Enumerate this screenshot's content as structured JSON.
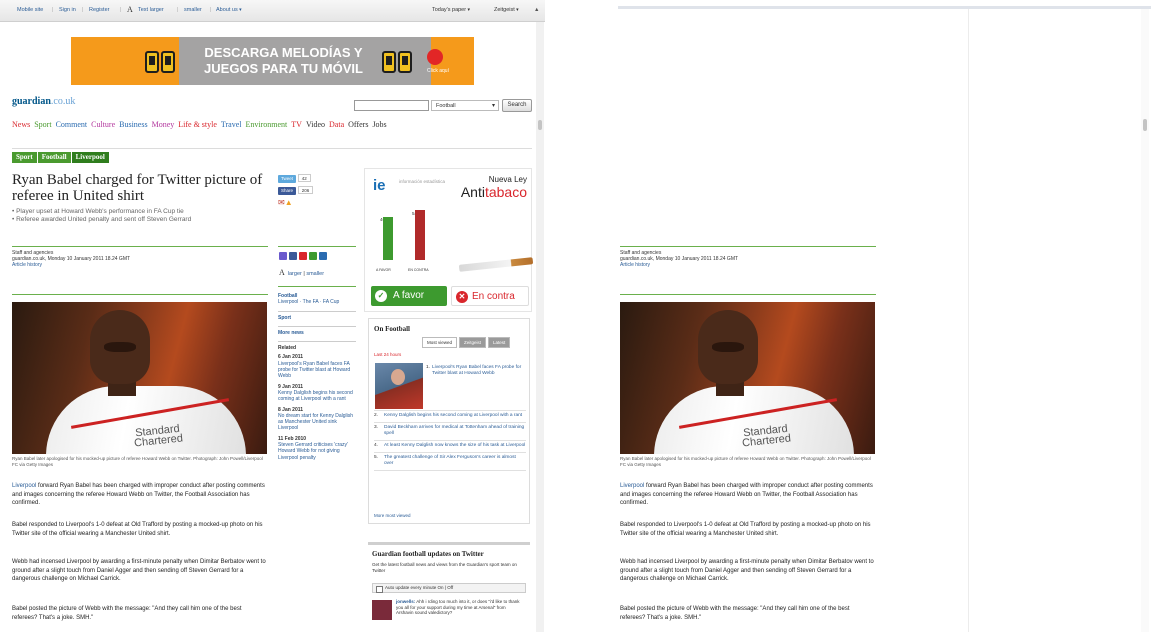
{
  "topbar": {
    "links": [
      "Mobile site",
      "Sign in",
      "Register",
      "Text larger",
      "smaller",
      "About us"
    ],
    "text_glyph": "A",
    "todays_paper": "Today's paper",
    "zeitgeist": "Zeitgeist"
  },
  "ad": {
    "text": "DESCARGA MELODÍAS Y JUEGOS PARA TU MÓVIL",
    "click": "Click aquí"
  },
  "logo": {
    "main": "guardian",
    "suffix": ".co.uk"
  },
  "search": {
    "select_value": "Football",
    "button": "Search"
  },
  "nav": {
    "items": [
      {
        "label": "News",
        "color": "#d9262c"
      },
      {
        "label": "Sport",
        "color": "#4a9a2f"
      },
      {
        "label": "Comment",
        "color": "#2a6bb0"
      },
      {
        "label": "Culture",
        "color": "#b3379e"
      },
      {
        "label": "Business",
        "color": "#2a6bb0"
      },
      {
        "label": "Money",
        "color": "#b3379e"
      },
      {
        "label": "Life & style",
        "color": "#d9262c"
      },
      {
        "label": "Travel",
        "color": "#2a6bb0"
      },
      {
        "label": "Environment",
        "color": "#4a9a2f"
      },
      {
        "label": "TV",
        "color": "#d9262c"
      },
      {
        "label": "Video",
        "color": "#333333"
      },
      {
        "label": "Data",
        "color": "#d9262c"
      },
      {
        "label": "Offers",
        "color": "#333333"
      },
      {
        "label": "Jobs",
        "color": "#333333"
      }
    ]
  },
  "breadcrumbs": [
    "Sport",
    "Football",
    "Liverpool"
  ],
  "article": {
    "headline": "Ryan Babel charged for Twitter picture of referee in United shirt",
    "standfirst": [
      "• Player upset at Howard Webb's performance in FA Cup tie",
      "• Referee awarded United penalty and sent off Steven Gerrard"
    ],
    "byline": {
      "author": "Staff and agencies",
      "date": "guardian.co.uk, Monday 10 January 2011 18.24 GMT",
      "history": "Article history"
    },
    "photo_sponsor": "Standard Chartered",
    "caption": "Ryan Babel later apologised for his mocked-up picture of referee Howard Webb on Twitter. Photograph: John Powell/Liverpool FC via Getty Images",
    "p1_link": "Liverpool",
    "p1_rest": " forward Ryan Babel has been charged with improper conduct after posting comments and images concerning the referee Howard Webb on Twitter, the Football Association has confirmed.",
    "p2": "Babel responded to Liverpool's 1-0 defeat at Old Trafford by posting a mocked-up photo on his Twitter site of the official wearing a Manchester United shirt.",
    "p3": "Webb had incensed Liverpool by awarding a first-minute penalty when Dimitar Berbatov went to ground after a slight touch from Daniel Agger and then sending off Steven Gerrard for a dangerous challenge on Michael Carrick.",
    "p4": "Babel posted the picture of Webb with the message: \"And they call him one of the best referees? That's a joke. SMH.\""
  },
  "share": {
    "tweet": "Tweet",
    "tweet_count": "42",
    "fb": "Share",
    "fb_count": "206"
  },
  "textsize": {
    "glyph": "A",
    "larger": "larger",
    "smaller": "smaller"
  },
  "sidecol": {
    "football": "Football",
    "football_links": "Liverpool · The FA · FA Cup",
    "sport": "Sport",
    "more_news": "More news",
    "related": "Related",
    "items": [
      {
        "date": "6 Jan 2011",
        "text": "Liverpool's Ryan Babel faces FA probe for Twitter blast at Howard Webb"
      },
      {
        "date": "9 Jan 2011",
        "text": "Kenny Dalglish begins his second coming at Liverpool with a rant"
      },
      {
        "date": "8 Jan 2011",
        "text": "No dream start for Kenny Dalglish as Manchester United sink Liverpool"
      },
      {
        "date": "11 Feb 2010",
        "text": "Steven Gerrard criticises 'crazy' Howard Webb for not giving Liverpool penalty"
      }
    ]
  },
  "mpu": {
    "ie": "ie",
    "ie_sub": "información estadística",
    "nueva_ley": "Nueva Ley",
    "anti": "Anti",
    "tabaco": "tabaco",
    "pct_favor": "46%",
    "pct_contra": "54%",
    "lab_favor": "A FAVOR",
    "lab_contra": "EN CONTRA",
    "favor": "A favor",
    "contra": "En contra",
    "favor_level": 0.46,
    "contra_level": 0.54,
    "favor_color": "#3d9a2f",
    "contra_color": "#b02a2a"
  },
  "onfootball": {
    "title": "On Football",
    "tabs": [
      "Most viewed",
      "Zeitgeist",
      "Latest"
    ],
    "last_day": "Last 24 hours",
    "items": [
      "Liverpool's Ryan Babel faces FA probe for Twitter blast at Howard Webb",
      "Kenny Dalglish begins his second coming at Liverpool with a rant",
      "David Beckham arrives for medical at Tottenham ahead of training spell",
      "At least Kenny Dalglish now knows the size of his task at Liverpool",
      "The greatest challenge of Sir Alex Ferguson's career is almost over"
    ],
    "more": "More most viewed"
  },
  "twitter": {
    "title": "Guardian football updates on Twitter",
    "desc": "Get the latest football news and views from the Guardian's sport team on Twitter",
    "auto": "Auto update every minute On | Off",
    "handle": "jonwells:",
    "tweet": "Ahh i rding too much into it, or does \"i'd like to thank you all for your support during my time at Arsenal\" from Arshavin sound valedictory?"
  },
  "right": {
    "byline_author": "Staff and agencies",
    "byline_date": "guardian.co.uk, Monday 10 January 2011 18.24 GMT",
    "byline_history": "Article history"
  }
}
